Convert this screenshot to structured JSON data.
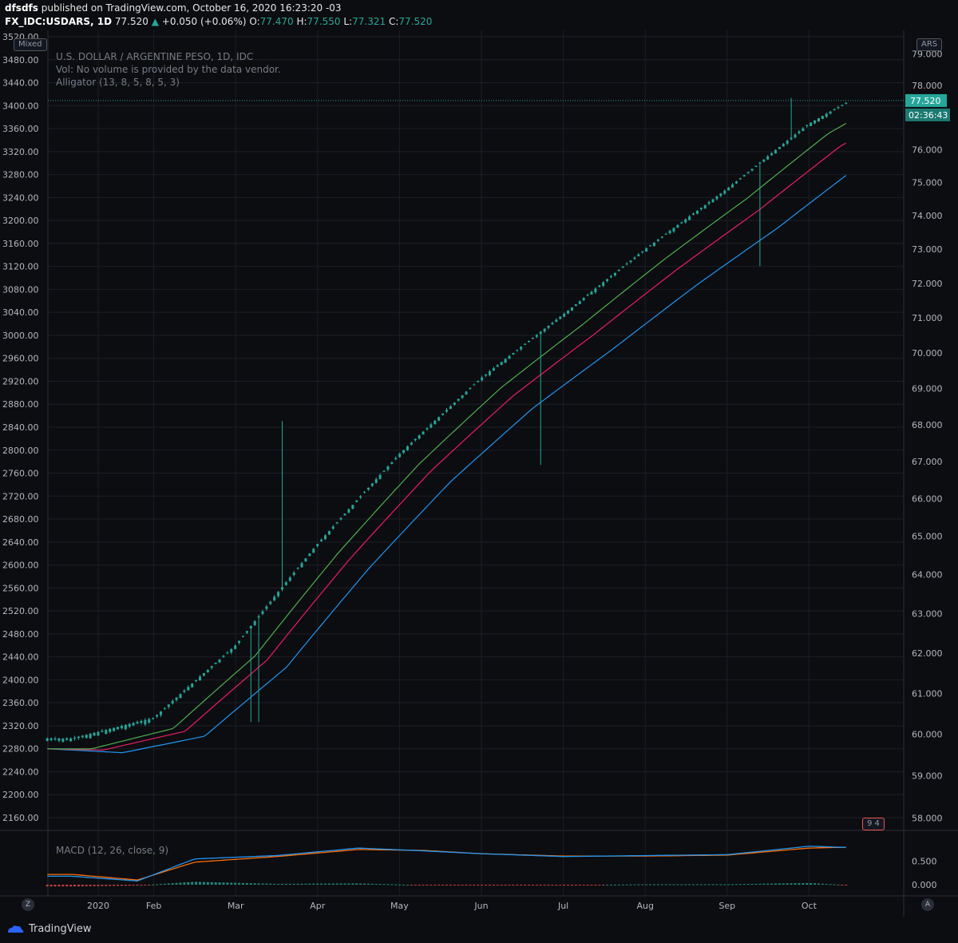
{
  "header": {
    "author": "dfsdfs",
    "published": "published on TradingView.com, October 16, 2020 16:23:20 -03",
    "symbol": "FX_IDC:USDARS, 1D",
    "last": "77.520",
    "change": "+0.050 (+0.06%)",
    "open_label": "O:",
    "open": "77.470",
    "high_label": "H:",
    "high": "77.550",
    "low_label": "L:",
    "low": "77.321",
    "close_label": "C:",
    "close": "77.520"
  },
  "legend": {
    "title": "U.S. DOLLAR / ARGENTINE PESO, 1D, IDC",
    "vol": "Vol: No volume is provided by the data vendor.",
    "alligator": "Alligator (13, 8, 5, 8, 5, 3)",
    "macd": "MACD (12, 26, close, 9)"
  },
  "badges": {
    "left_scale": "Mixed",
    "right_scale": "ARS",
    "flag_text": "9 4"
  },
  "price_tag": {
    "value": "77.520",
    "countdown": "02:36:43"
  },
  "corner_buttons": {
    "left": "Z",
    "right": "A"
  },
  "footer": {
    "logo_text": "TradingView"
  },
  "colors": {
    "background": "#0c0d10",
    "up": "#26a69a",
    "down": "#ef5350",
    "jaw": "#2196f3",
    "teeth": "#e91e63",
    "lips": "#4caf50",
    "macd_line": "#2196f3",
    "signal_line": "#ff6d00",
    "grid": "#1c1f26"
  },
  "chart_data": {
    "type": "candlestick",
    "title": "U.S. DOLLAR / ARGENTINE PESO, 1D, IDC",
    "x_ticks": [
      "2020",
      "Feb",
      "Mar",
      "Apr",
      "May",
      "Jun",
      "Jul",
      "Aug",
      "Sep",
      "Oct"
    ],
    "left_axis": {
      "ticks": [
        "3520.00",
        "3480.00",
        "3440.00",
        "3400.00",
        "3360.00",
        "3320.00",
        "3280.00",
        "3240.00",
        "3200.00",
        "3160.00",
        "3120.00",
        "3080.00",
        "3040.00",
        "3000.00",
        "2960.00",
        "2920.00",
        "2880.00",
        "2840.00",
        "2800.00",
        "2760.00",
        "2720.00",
        "2680.00",
        "2640.00",
        "2600.00",
        "2560.00",
        "2520.00",
        "2480.00",
        "2440.00",
        "2400.00",
        "2360.00",
        "2320.00",
        "2280.00",
        "2240.00",
        "2200.00",
        "2160.00"
      ]
    },
    "right_axis": {
      "ticks": [
        "79.000",
        "78.000",
        "77.000",
        "76.000",
        "75.000",
        "74.000",
        "73.000",
        "72.000",
        "71.000",
        "70.000",
        "69.000",
        "68.000",
        "67.000",
        "66.000",
        "65.000",
        "64.000",
        "63.000",
        "62.000",
        "61.000",
        "60.000",
        "59.000",
        "58.000"
      ],
      "ylim": [
        57.9,
        79.7
      ],
      "scale": "log"
    },
    "price_anchors": {
      "months": [
        0,
        1,
        2,
        3,
        4,
        5,
        6,
        7,
        8,
        9,
        9.5
      ],
      "close": [
        59.9,
        60.4,
        62.2,
        64.8,
        67.2,
        69.3,
        71.1,
        73.0,
        74.8,
        76.8,
        77.52
      ]
    },
    "alligator": {
      "jaw_end": 76.3,
      "teeth_end": 76.9,
      "lips_end": 77.4
    },
    "macd": {
      "ticks": [
        "0.500",
        "0.000"
      ],
      "macd_anchors_months": [
        0,
        0.8,
        1.5,
        2.5,
        3.5,
        4.3,
        5,
        6,
        7,
        8,
        9,
        9.5
      ],
      "macd_values": [
        0.18,
        0.08,
        0.55,
        0.62,
        0.78,
        0.72,
        0.66,
        0.6,
        0.62,
        0.64,
        0.82,
        0.79
      ],
      "signal_values": [
        0.22,
        0.1,
        0.48,
        0.6,
        0.75,
        0.73,
        0.66,
        0.61,
        0.61,
        0.63,
        0.78,
        0.8
      ]
    }
  }
}
